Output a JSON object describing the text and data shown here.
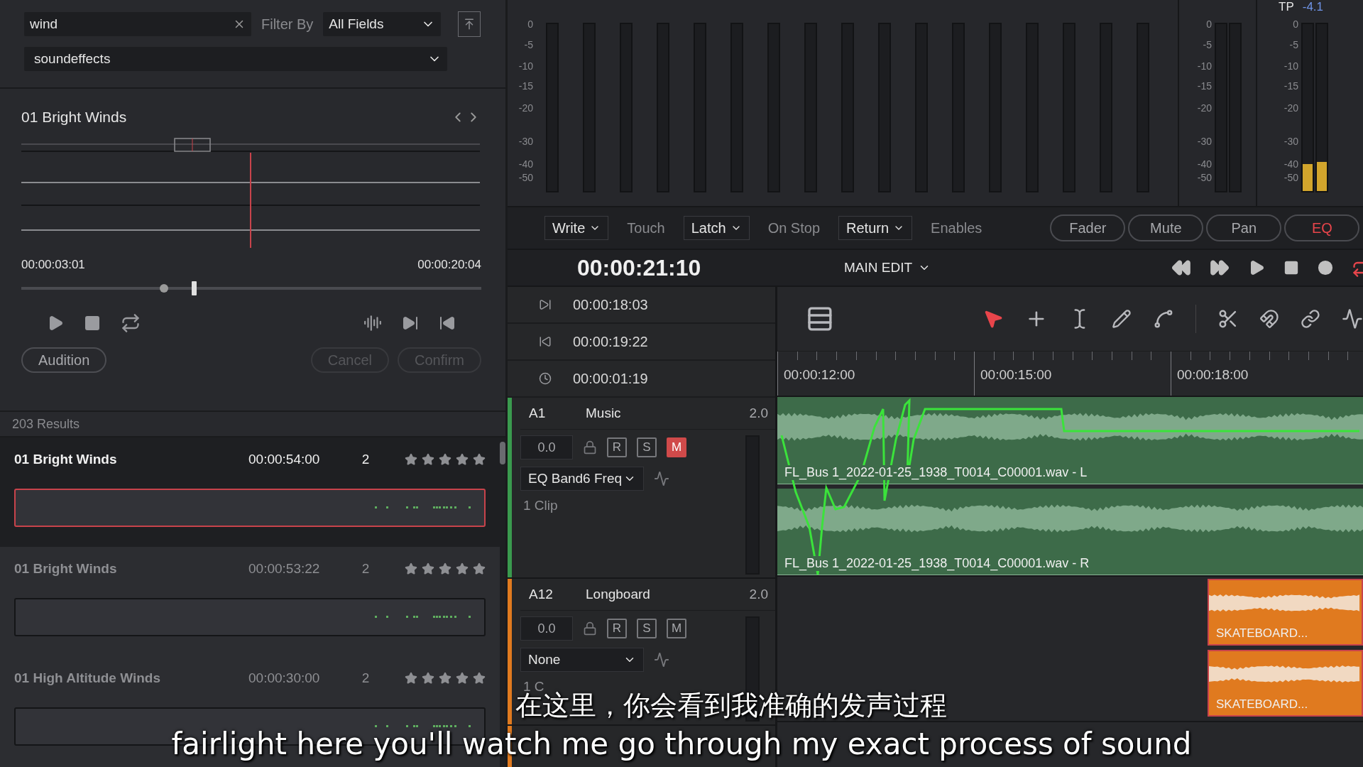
{
  "search": {
    "value": "wind",
    "filter_label": "Filter By",
    "filter": "All Fields",
    "library": "soundeffects"
  },
  "preview": {
    "title": "01 Bright Winds",
    "start": "00:00:03:01",
    "end": "00:00:20:04",
    "zoom": {
      "level": 0.37
    },
    "buttons": [
      {
        "label": "Audition",
        "disabled": false
      },
      {
        "label": "Cancel",
        "disabled": true
      },
      {
        "label": "Confirm",
        "disabled": true
      }
    ]
  },
  "results": {
    "count": "203 Results",
    "items": [
      {
        "name": "01 Bright Winds",
        "duration": "00:00:54:00",
        "channels": "2",
        "stars": 5,
        "selected": true
      },
      {
        "name": "01 Bright Winds",
        "duration": "00:00:53:22",
        "channels": "2",
        "stars": 5,
        "selected": false
      },
      {
        "name": "01 High Altitude Winds",
        "duration": "00:00:30:00",
        "channels": "2",
        "stars": 5,
        "selected": false
      }
    ]
  },
  "meters": {
    "scales": [
      [
        "0",
        "-5",
        "-10",
        "-15",
        "-20",
        "-30",
        "-40",
        "-50"
      ],
      [
        "0",
        "-5",
        "-10",
        "-15",
        "-20",
        "-30",
        "-40",
        "-50"
      ],
      [
        "0",
        "-5",
        "-10",
        "-15",
        "-20",
        "-30",
        "-40",
        "-50"
      ]
    ],
    "main": {
      "label": "TP",
      "reading": "-4.1",
      "level": 0.16
    }
  },
  "automation": {
    "modes": [
      {
        "label": "Write",
        "kind": "dropdown"
      },
      {
        "label": "Touch",
        "kind": "text"
      },
      {
        "label": "Latch",
        "kind": "dropdown"
      },
      {
        "label": "On Stop",
        "kind": "text"
      },
      {
        "label": "Return",
        "kind": "dropdown"
      },
      {
        "label": "Enables",
        "kind": "text"
      }
    ],
    "enables": [
      {
        "label": "Fader",
        "selected": false
      },
      {
        "label": "Mute",
        "selected": false
      },
      {
        "label": "Pan",
        "selected": false
      },
      {
        "label": "EQ",
        "selected": true
      }
    ]
  },
  "transport": {
    "timecode": "00:00:21:10",
    "timeline": "MAIN EDIT"
  },
  "markers": [
    {
      "kind": "in",
      "time": "00:00:18:03"
    },
    {
      "kind": "out",
      "time": "00:00:19:22"
    },
    {
      "kind": "duration",
      "time": "00:00:01:19"
    }
  ],
  "ruler": [
    "00:00:12:00",
    "00:00:15:00",
    "00:00:18:00"
  ],
  "tracks": [
    {
      "id": "A1",
      "name": "Music",
      "format": "2.0",
      "volume": "0.0",
      "buttons": [
        {
          "label": "R",
          "on": false
        },
        {
          "label": "S",
          "on": false
        },
        {
          "label": "M",
          "on": true
        }
      ],
      "automation": "EQ Band6 Freq",
      "clips": "1 Clip",
      "color": "#3a9a4e",
      "kind": "long",
      "clip_labels": [
        "FL_Bus 1_2022-01-25_1938_T0014_C00001.wav - L",
        "FL_Bus 1_2022-01-25_1938_T0014_C00001.wav - R"
      ]
    },
    {
      "id": "A12",
      "name": "Longboard",
      "format": "2.0",
      "volume": "0.0",
      "buttons": [
        {
          "label": "R",
          "on": false
        },
        {
          "label": "S",
          "on": false
        },
        {
          "label": "M",
          "on": false
        }
      ],
      "automation": "None",
      "clips": "1 C",
      "color": "#e07a1f",
      "kind": "short",
      "clip_labels": [
        "SKATEBOARD...",
        "SKATEBOARD..."
      ]
    }
  ],
  "subtitles": [
    "在这里，你会看到我准确的发声过程",
    "fairlight here you'll watch me go through my exact process of sound"
  ]
}
